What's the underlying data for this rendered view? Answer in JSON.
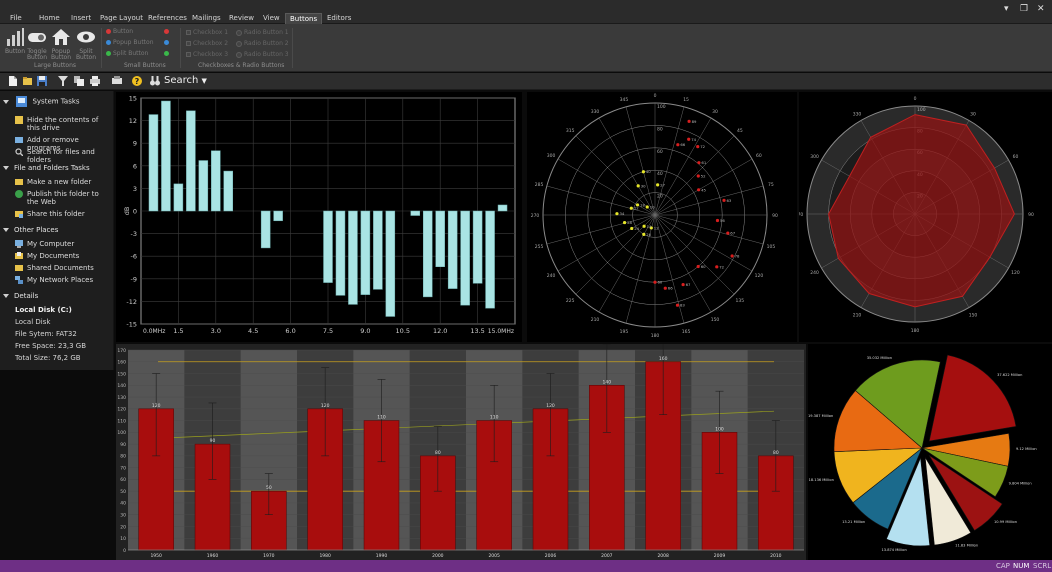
{
  "ribbon": {
    "file_tab": "File",
    "tabs": [
      "Home",
      "Insert",
      "Page Layout",
      "References",
      "Mailings",
      "Review",
      "View",
      "Buttons",
      "Editors"
    ],
    "active_tab": "Buttons",
    "large_buttons": [
      "Button",
      "Toggle Button",
      "Popup Button",
      "Split Button"
    ],
    "large_group_label": "Large Buttons",
    "small_buttons": [
      "Button",
      "Popup Button",
      "Split Button"
    ],
    "small_group_label": "Small Buttons",
    "checkboxes": [
      "Checkbox 1",
      "Checkbox 2",
      "Checkbox 3"
    ],
    "radios": [
      "Radio Button 1",
      "Radio Button 2",
      "Radio Button 3"
    ],
    "cb_group_label": "Checkboxes & Radio Buttons",
    "window_controls": [
      "▾",
      "❐",
      "✕"
    ]
  },
  "toolbar": {
    "search_label": "Search"
  },
  "side": {
    "sections": [
      {
        "title": "System Tasks",
        "items": [
          "Hide the contents of this drive",
          "Add or remove programs",
          "Search for files and folders"
        ]
      },
      {
        "title": "File and Folders Tasks",
        "items": [
          "Make a new folder",
          "Publish this folder to the Web",
          "Share this folder"
        ]
      },
      {
        "title": "Other Places",
        "items": [
          "My Computer",
          "My Documents",
          "Shared Documents",
          "My Network Places"
        ]
      }
    ],
    "details_title": "Details",
    "details": [
      "Local Disk (C:)",
      "Local Disk",
      "File Sytem: FAT32",
      "Free Space: 23,3 GB",
      "Total Size: 76,2 GB"
    ]
  },
  "status": {
    "items": [
      "CAP",
      "NUM",
      "SCRL"
    ],
    "active": "NUM"
  },
  "chart_data": [
    {
      "type": "bar",
      "x_ticks": [
        "1.5",
        "3.0",
        "4.5",
        "6.0",
        "7.5",
        "9.0",
        "10.5",
        "12.0",
        "13.5"
      ],
      "x_first_label": "0.0",
      "x_last_label": "15.0",
      "x_unit": "MHz",
      "ylabel": "dB",
      "ylim": [
        -15,
        15
      ],
      "y_ticks": [
        "15",
        "12",
        "9",
        "6",
        "3",
        "0",
        "-3",
        "-6",
        "-9",
        "-12",
        "-15"
      ],
      "x": [
        0.5,
        1.0,
        1.5,
        2.0,
        2.5,
        3.0,
        3.5,
        4.0,
        4.5,
        5.0,
        5.5,
        6.0,
        6.5,
        7.0,
        7.5,
        8.0,
        8.5,
        9.0,
        9.5,
        10.0,
        10.5,
        11.0,
        11.5,
        12.0,
        12.5,
        13.0,
        13.5,
        14.0,
        14.5
      ],
      "values": [
        12.8,
        14.6,
        3.6,
        13.3,
        6.7,
        8.0,
        5.3,
        0,
        0,
        -4.9,
        -1.3,
        0,
        0,
        0,
        -9.5,
        -11.2,
        -12.4,
        -11.1,
        -10.4,
        -14.0,
        0,
        -0.6,
        -11.4,
        -7.4,
        -10.3,
        -12.5,
        -9.6,
        -12.9,
        0.8
      ]
    },
    {
      "type": "scatter",
      "projection": "polar",
      "angle_labels": [
        "0",
        "15",
        "30",
        "45",
        "60",
        "75",
        "90",
        "105",
        "120",
        "135",
        "150",
        "165",
        "180",
        "195",
        "210",
        "225",
        "240",
        "255",
        "270",
        "285",
        "300",
        "315",
        "330",
        "345"
      ],
      "radial_labels": [
        "20",
        "40",
        "60",
        "80",
        "100"
      ],
      "series": [
        {
          "color": "#d81e1e",
          "points": [
            [
              18,
              66
            ],
            [
              24,
              74
            ],
            [
              32,
              72
            ],
            [
              40,
              61
            ],
            [
              48,
              52
            ],
            [
              60,
              45
            ],
            [
              78,
              63
            ],
            [
              95,
              56
            ],
            [
              104,
              67
            ],
            [
              118,
              78
            ],
            [
              130,
              72
            ],
            [
              140,
              60
            ],
            [
              158,
              67
            ],
            [
              166,
              83
            ],
            [
              172,
              66
            ],
            [
              180,
              60
            ],
            [
              20,
              89
            ]
          ]
        },
        {
          "color": "#e6e62a",
          "points": [
            [
              196,
              12
            ],
            [
              210,
              20
            ],
            [
              224,
              14
            ],
            [
              240,
              24
            ],
            [
              256,
              28
            ],
            [
              272,
              34
            ],
            [
              286,
              22
            ],
            [
              300,
              18
            ],
            [
              316,
              10
            ],
            [
              330,
              30
            ],
            [
              345,
              40
            ],
            [
              5,
              27
            ]
          ]
        }
      ]
    },
    {
      "type": "area",
      "projection": "radar",
      "angle_labels": [
        "0",
        "30",
        "60",
        "90",
        "120",
        "150",
        "180",
        "210",
        "240",
        "270",
        "300",
        "330"
      ],
      "radial_labels": [
        "20",
        "40",
        "60",
        "80",
        "100"
      ],
      "values": [
        92,
        95,
        85,
        92,
        80,
        88,
        86,
        85,
        82,
        80,
        70,
        82
      ]
    },
    {
      "type": "bar",
      "categories": [
        "1950",
        "1960",
        "1970",
        "1980",
        "1990",
        "2000",
        "2005",
        "2006",
        "2007",
        "2008",
        "2009",
        "2010"
      ],
      "values": [
        120,
        90,
        50,
        120,
        110,
        80,
        110,
        120,
        140,
        160,
        100,
        80
      ],
      "error_low": [
        80,
        60,
        30,
        80,
        75,
        50,
        75,
        80,
        100,
        115,
        65,
        50
      ],
      "error_high": [
        150,
        125,
        65,
        155,
        145,
        105,
        140,
        150,
        175,
        185,
        135,
        110
      ],
      "ylim": [
        0,
        170
      ],
      "y_ticks": [
        "0",
        "10",
        "20",
        "30",
        "40",
        "50",
        "60",
        "70",
        "80",
        "90",
        "100",
        "110",
        "120",
        "130",
        "140",
        "150",
        "160",
        "170"
      ],
      "constant_lines": [
        160,
        50
      ],
      "trend_line": [
        95,
        118
      ]
    },
    {
      "type": "pie",
      "slices": [
        {
          "label": "37.622 Million",
          "value": 19,
          "color": "#a50f0f",
          "exploded": true
        },
        {
          "label": "9.12 Million",
          "value": 6,
          "color": "#e67a12"
        },
        {
          "label": "9.804 Million",
          "value": 6,
          "color": "#7d9c1a"
        },
        {
          "label": "10.99 Million",
          "value": 7,
          "color": "#9c1212",
          "exploded": true
        },
        {
          "label": "11.83 Million",
          "value": 7,
          "color": "#f0ead8",
          "exploded": true
        },
        {
          "label": "13.874 Million",
          "value": 8,
          "color": "#b4e0f0",
          "exploded": true
        },
        {
          "label": "13.21 Million",
          "value": 8,
          "color": "#1b6a8c"
        },
        {
          "label": "18.136 Million",
          "value": 10,
          "color": "#f0b41e"
        },
        {
          "label": "19.387 Million",
          "value": 12,
          "color": "#e86a12"
        },
        {
          "label": "35.032 Million",
          "value": 17,
          "color": "#6e9c1e"
        }
      ]
    }
  ],
  "icons": [
    "bars-icon",
    "toggle-icon",
    "home-icon",
    "eye-icon",
    "new-file-icon",
    "open-folder-icon",
    "save-icon",
    "filter-icon",
    "copy-icon",
    "print-icon",
    "help-icon",
    "binoculars-icon"
  ]
}
